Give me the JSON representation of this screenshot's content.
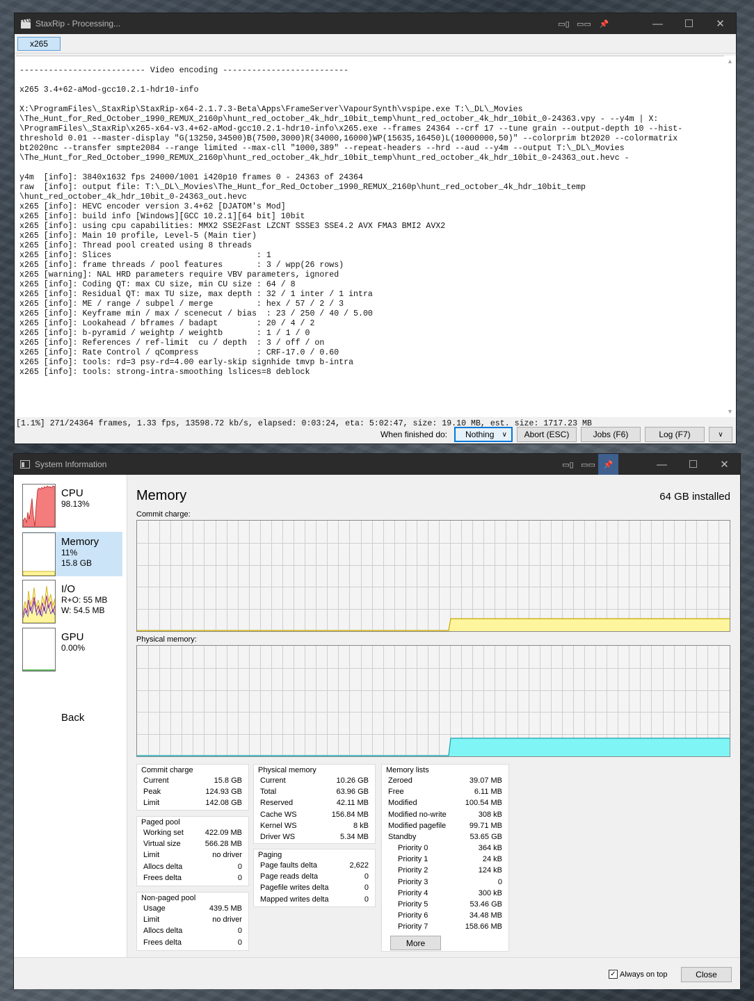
{
  "staxrip": {
    "title": "StaxRip - Processing...",
    "tab": "x265",
    "log_lines": [
      "-------------------------- Video encoding --------------------------",
      "",
      "x265 3.4+62-aMod-gcc10.2.1-hdr10-info",
      "",
      "X:\\ProgramFiles\\_StaxRip\\StaxRip-x64-2.1.7.3-Beta\\Apps\\FrameServer\\VapourSynth\\vspipe.exe T:\\_DL\\_Movies",
      "\\The_Hunt_for_Red_October_1990_REMUX_2160p\\hunt_red_october_4k_hdr_10bit_temp\\hunt_red_october_4k_hdr_10bit_0-24363.vpy - --y4m | X:",
      "\\ProgramFiles\\_StaxRip\\x265-x64-v3.4+62-aMod-gcc10.2.1-hdr10-info\\x265.exe --frames 24364 --crf 17 --tune grain --output-depth 10 --hist-",
      "threshold 0.01 --master-display \"G(13250,34500)B(7500,3000)R(34000,16000)WP(15635,16450)L(10000000,50)\" --colorprim bt2020 --colormatrix",
      "bt2020nc --transfer smpte2084 --range limited --max-cll \"1000,389\" --repeat-headers --hrd --aud --y4m --output T:\\_DL\\_Movies",
      "\\The_Hunt_for_Red_October_1990_REMUX_2160p\\hunt_red_october_4k_hdr_10bit_temp\\hunt_red_october_4k_hdr_10bit_0-24363_out.hevc -",
      "",
      "y4m  [info]: 3840x1632 fps 24000/1001 i420p10 frames 0 - 24363 of 24364",
      "raw  [info]: output file: T:\\_DL\\_Movies\\The_Hunt_for_Red_October_1990_REMUX_2160p\\hunt_red_october_4k_hdr_10bit_temp",
      "\\hunt_red_october_4k_hdr_10bit_0-24363_out.hevc",
      "x265 [info]: HEVC encoder version 3.4+62 [DJATOM's Mod]",
      "x265 [info]: build info [Windows][GCC 10.2.1][64 bit] 10bit",
      "x265 [info]: using cpu capabilities: MMX2 SSE2Fast LZCNT SSSE3 SSE4.2 AVX FMA3 BMI2 AVX2",
      "x265 [info]: Main 10 profile, Level-5 (Main tier)",
      "x265 [info]: Thread pool created using 8 threads",
      "x265 [info]: Slices                              : 1",
      "x265 [info]: frame threads / pool features       : 3 / wpp(26 rows)",
      "x265 [warning]: NAL HRD parameters require VBV parameters, ignored",
      "x265 [info]: Coding QT: max CU size, min CU size : 64 / 8",
      "x265 [info]: Residual QT: max TU size, max depth : 32 / 1 inter / 1 intra",
      "x265 [info]: ME / range / subpel / merge         : hex / 57 / 2 / 3",
      "x265 [info]: Keyframe min / max / scenecut / bias  : 23 / 250 / 40 / 5.00",
      "x265 [info]: Lookahead / bframes / badapt        : 20 / 4 / 2",
      "x265 [info]: b-pyramid / weightp / weightb       : 1 / 1 / 0",
      "x265 [info]: References / ref-limit  cu / depth  : 3 / off / on",
      "x265 [info]: Rate Control / qCompress            : CRF-17.0 / 0.60",
      "x265 [info]: tools: rd=3 psy-rd=4.00 early-skip signhide tmvp b-intra",
      "x265 [info]: tools: strong-intra-smoothing lslices=8 deblock"
    ],
    "status": "[1.1%] 271/24364 frames, 1.33 fps, 13598.72 kb/s, elapsed: 0:03:24, eta: 5:02:47, size: 19.10 MB, est. size: 1717.23 MB",
    "when_finished_label": "When finished do:",
    "when_finished_value": "Nothing",
    "abort_label": "Abort (ESC)",
    "jobs_label": "Jobs (F6)",
    "log_label": "Log (F7)"
  },
  "sysinfo": {
    "title": "System Information",
    "sidebar": {
      "cpu": {
        "name": "CPU",
        "value": "98.13%"
      },
      "memory": {
        "name": "Memory",
        "percent": "11%",
        "amount": "15.8 GB"
      },
      "io": {
        "name": "I/O",
        "read": "R+O: 55 MB",
        "write": "W: 54.5 MB"
      },
      "gpu": {
        "name": "GPU",
        "value": "0.00%"
      },
      "back": "Back"
    },
    "heading": "Memory",
    "installed": "64 GB installed",
    "commit_graph_label": "Commit charge:",
    "physical_graph_label": "Physical memory:",
    "commit_charge": {
      "title": "Commit charge",
      "rows": [
        [
          "Current",
          "15.8 GB"
        ],
        [
          "Peak",
          "124.93 GB"
        ],
        [
          "Limit",
          "142.08 GB"
        ]
      ]
    },
    "paged_pool": {
      "title": "Paged pool",
      "rows": [
        [
          "Working set",
          "422.09 MB"
        ],
        [
          "Virtual size",
          "566.28 MB"
        ],
        [
          "Limit",
          "no driver"
        ],
        [
          "Allocs delta",
          "0"
        ],
        [
          "Frees delta",
          "0"
        ]
      ]
    },
    "nonpaged_pool": {
      "title": "Non-paged pool",
      "rows": [
        [
          "Usage",
          "439.5 MB"
        ],
        [
          "Limit",
          "no driver"
        ],
        [
          "Allocs delta",
          "0"
        ],
        [
          "Frees delta",
          "0"
        ]
      ]
    },
    "physical_memory": {
      "title": "Physical memory",
      "rows": [
        [
          "Current",
          "10.26 GB"
        ],
        [
          "Total",
          "63.96 GB"
        ],
        [
          "Reserved",
          "42.11 MB"
        ],
        [
          "Cache WS",
          "156.84 MB"
        ],
        [
          "Kernel WS",
          "8 kB"
        ],
        [
          "Driver WS",
          "5.34 MB"
        ]
      ]
    },
    "paging": {
      "title": "Paging",
      "rows": [
        [
          "Page faults delta",
          "2,622"
        ],
        [
          "Page reads delta",
          "0"
        ],
        [
          "Pagefile writes delta",
          "0"
        ],
        [
          "Mapped writes delta",
          "0"
        ]
      ]
    },
    "memory_lists": {
      "title": "Memory lists",
      "rows": [
        [
          "Zeroed",
          "39.07 MB"
        ],
        [
          "Free",
          "6.11 MB"
        ],
        [
          "Modified",
          "100.54 MB"
        ],
        [
          "Modified no-write",
          "308 kB"
        ],
        [
          "Modified pagefile",
          "99.71 MB"
        ],
        [
          "Standby",
          "53.65 GB"
        ]
      ],
      "priorities": [
        [
          "Priority 0",
          "364 kB"
        ],
        [
          "Priority 1",
          "24 kB"
        ],
        [
          "Priority 2",
          "124 kB"
        ],
        [
          "Priority 3",
          "0"
        ],
        [
          "Priority 4",
          "300 kB"
        ],
        [
          "Priority 5",
          "53.46 GB"
        ],
        [
          "Priority 6",
          "34.48 MB"
        ],
        [
          "Priority 7",
          "158.66 MB"
        ]
      ],
      "more": "More"
    },
    "always_on_top": "Always on top",
    "close": "Close",
    "colors": {
      "commit_fill": "#fff59d",
      "commit_line": "#c8a800",
      "physical_fill": "#7ff5f5",
      "physical_line": "#1aa0b0",
      "cpu_fill": "#f47c7c"
    }
  }
}
